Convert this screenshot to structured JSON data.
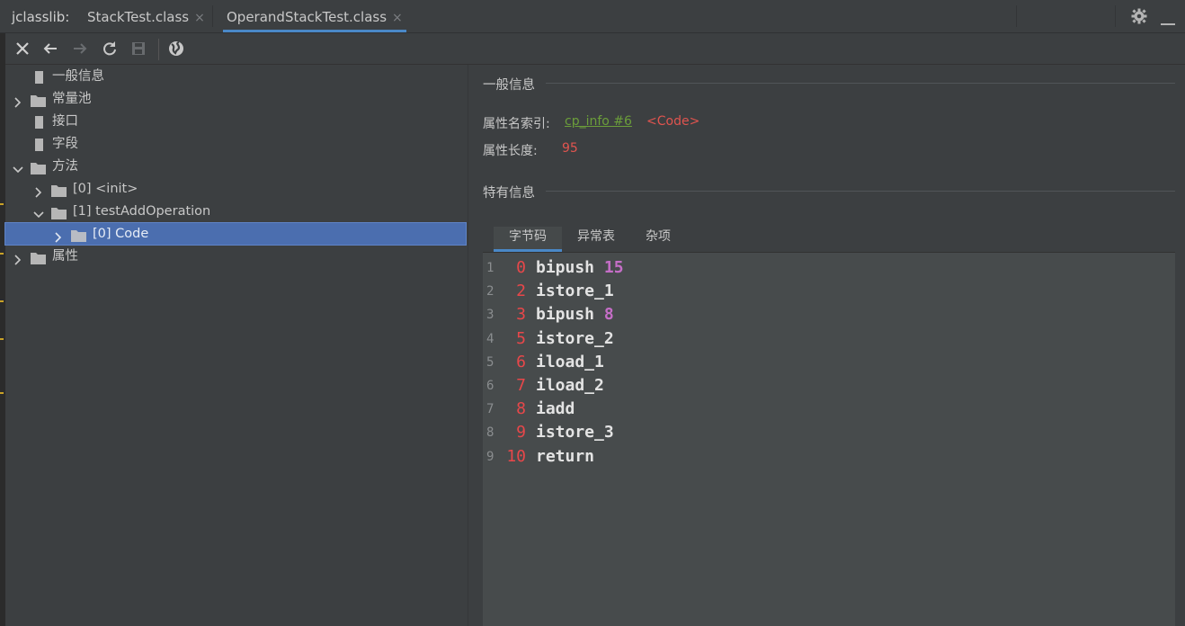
{
  "tabbar": {
    "app_label": "jclasslib:",
    "tabs": [
      {
        "label": "StackTest.class",
        "close": "×"
      },
      {
        "label": "OperandStackTest.class",
        "close": "×"
      }
    ]
  },
  "tree": {
    "items": [
      {
        "label": "一般信息"
      },
      {
        "label": "常量池"
      },
      {
        "label": "接口"
      },
      {
        "label": "字段"
      },
      {
        "label": "方法"
      },
      {
        "label": "[0] <init>"
      },
      {
        "label": "[1] testAddOperation"
      },
      {
        "label": "[0] Code"
      },
      {
        "label": "属性"
      }
    ]
  },
  "panel": {
    "general_title": "一般信息",
    "attr_name_label": "属性名索引:",
    "attr_name_link": "cp_info #6",
    "attr_name_value": "<Code>",
    "attr_len_label": "属性长度:",
    "attr_len_value": "95",
    "specific_title": "特有信息",
    "subtabs": [
      {
        "label": "字节码"
      },
      {
        "label": "异常表"
      },
      {
        "label": "杂项"
      }
    ]
  },
  "bytecode": [
    {
      "line": "1",
      "offset": "0",
      "op": "bipush",
      "arg": "15"
    },
    {
      "line": "2",
      "offset": "2",
      "op": "istore_1",
      "arg": ""
    },
    {
      "line": "3",
      "offset": "3",
      "op": "bipush",
      "arg": "8"
    },
    {
      "line": "4",
      "offset": "5",
      "op": "istore_2",
      "arg": ""
    },
    {
      "line": "5",
      "offset": "6",
      "op": "iload_1",
      "arg": ""
    },
    {
      "line": "6",
      "offset": "7",
      "op": "iload_2",
      "arg": ""
    },
    {
      "line": "7",
      "offset": "8",
      "op": "iadd",
      "arg": ""
    },
    {
      "line": "8",
      "offset": "9",
      "op": "istore_3",
      "arg": ""
    },
    {
      "line": "9",
      "offset": "10",
      "op": "return",
      "arg": ""
    }
  ]
}
